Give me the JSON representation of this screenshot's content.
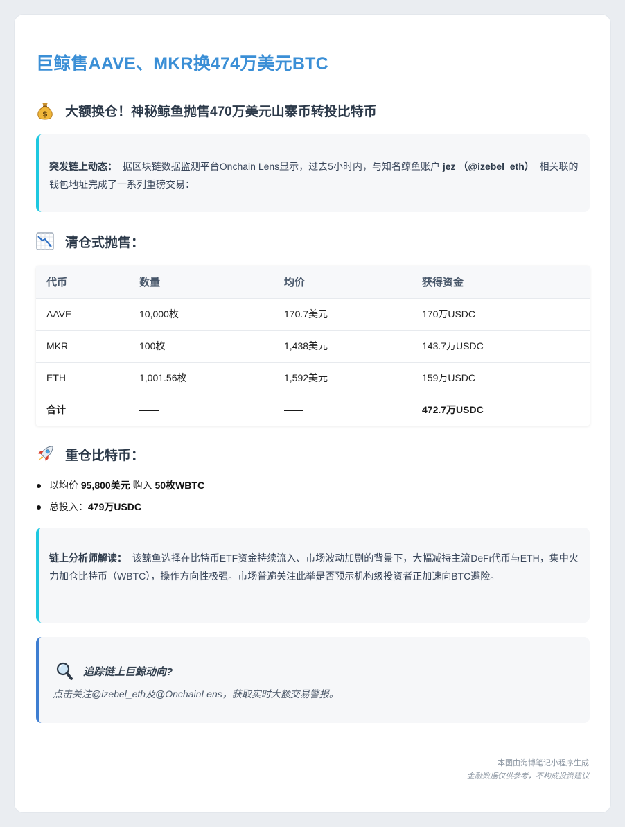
{
  "title": "巨鲸售AAVE、MKR换474万美元BTC",
  "headline": {
    "icon": "money-bag-icon",
    "text": "大额换仓！神秘鲸鱼抛售470万美元山寨币转投比特币"
  },
  "intro": {
    "label": "突发链上动态：",
    "text1": "据区块链数据监测平台Onchain Lens显示，过去5小时内，与知名鲸鱼账户",
    "account": "jez （@izebel_eth）",
    "text2": "相关联的钱包地址完成了一系列重磅交易："
  },
  "sell_section": {
    "icon": "chart-decreasing-icon",
    "title": "清仓式抛售："
  },
  "table": {
    "headers": [
      "代币",
      "数量",
      "均价",
      "获得资金"
    ],
    "rows": [
      [
        "AAVE",
        "10,000枚",
        "170.7美元",
        "170万USDC"
      ],
      [
        "MKR",
        "100枚",
        "1,438美元",
        "143.7万USDC"
      ],
      [
        "ETH",
        "1,001.56枚",
        "1,592美元",
        "159万USDC"
      ]
    ],
    "total": [
      "合计",
      "——",
      "——",
      "472.7万USDC"
    ]
  },
  "btc_section": {
    "icon": "rocket-icon",
    "title": "重仓比特币："
  },
  "bullets": {
    "b1_pre": "以均价",
    "b1_price": "95,800美元",
    "b1_mid": "购入",
    "b1_amount": "50枚WBTC",
    "b2_pre": "总投入：",
    "b2_amount": "479万USDC"
  },
  "analysis": {
    "label": "链上分析师解读：",
    "text": "该鲸鱼选择在比特币ETF资金持续流入、市场波动加剧的背景下，大幅减持主流DeFi代币与ETH，集中火力加仓比特币（WBTC），操作方向性极强。市场普遍关注此举是否预示机构级投资者正加速向BTC避险。"
  },
  "track": {
    "icon": "magnifier-icon",
    "title": "追踪链上巨鲸动向?",
    "text": "点击关注@izebel_eth及@OnchainLens，获取实时大额交易警报。"
  },
  "footer": {
    "line1": "本图由海博笔记小程序生成",
    "line2": "金融数据仅供参考，不构成投资建议"
  },
  "colors": {
    "title": "#3b8fd6",
    "callout_border": "#1ec8e0",
    "track_border": "#3e7ed1"
  }
}
